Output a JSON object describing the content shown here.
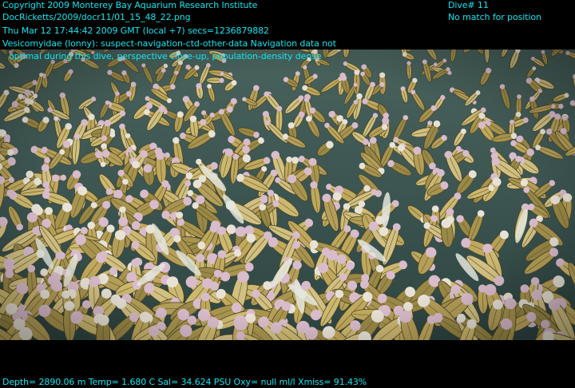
{
  "header": {
    "copyright": "Copyright 2009 Monterey Bay Aquarium Research Institute",
    "file_path": "DocRicketts/2009/docr11/01_15_48_22.png",
    "timestamp": "Thu Mar 12 17:44:42 2009 GMT (local +7)  secs=1236879882",
    "annotation_line1": "Vesicomyidae (lonny): suspect-navigation-ctd-other-data Navigation data not",
    "annotation_line2": "optimal during this dive, perspective close-up, population-density dense",
    "dive_number": "Dive# 11",
    "position_status": "No match for position"
  },
  "footer": {
    "telemetry": "Depth= 2890.06 m  Temp= 1.680 C  Sal= 34.624 PSU  Oxy= null ml/l  Xmiss= 91.43%"
  },
  "colors": {
    "overlay_text": "#13e6f0",
    "background": "#000000",
    "seafloor": "#3f5a56",
    "clam_shell": "#b8a45a",
    "clam_tip": "#d8b8c8"
  }
}
